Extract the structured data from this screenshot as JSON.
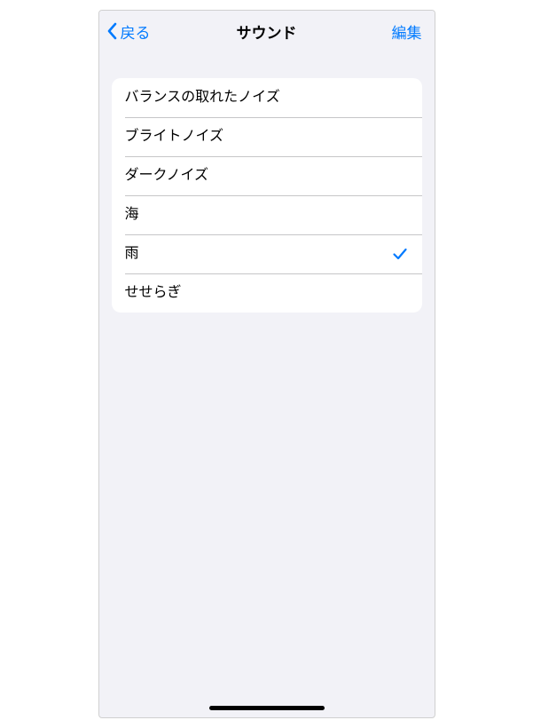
{
  "nav": {
    "back_label": "戻る",
    "title": "サウンド",
    "edit_label": "編集"
  },
  "sounds": {
    "items": [
      {
        "label": "バランスの取れたノイズ",
        "selected": false
      },
      {
        "label": "ブライトノイズ",
        "selected": false
      },
      {
        "label": "ダークノイズ",
        "selected": false
      },
      {
        "label": "海",
        "selected": false
      },
      {
        "label": "雨",
        "selected": true
      },
      {
        "label": "せせらぎ",
        "selected": false
      }
    ]
  },
  "accent_color": "#007aff"
}
